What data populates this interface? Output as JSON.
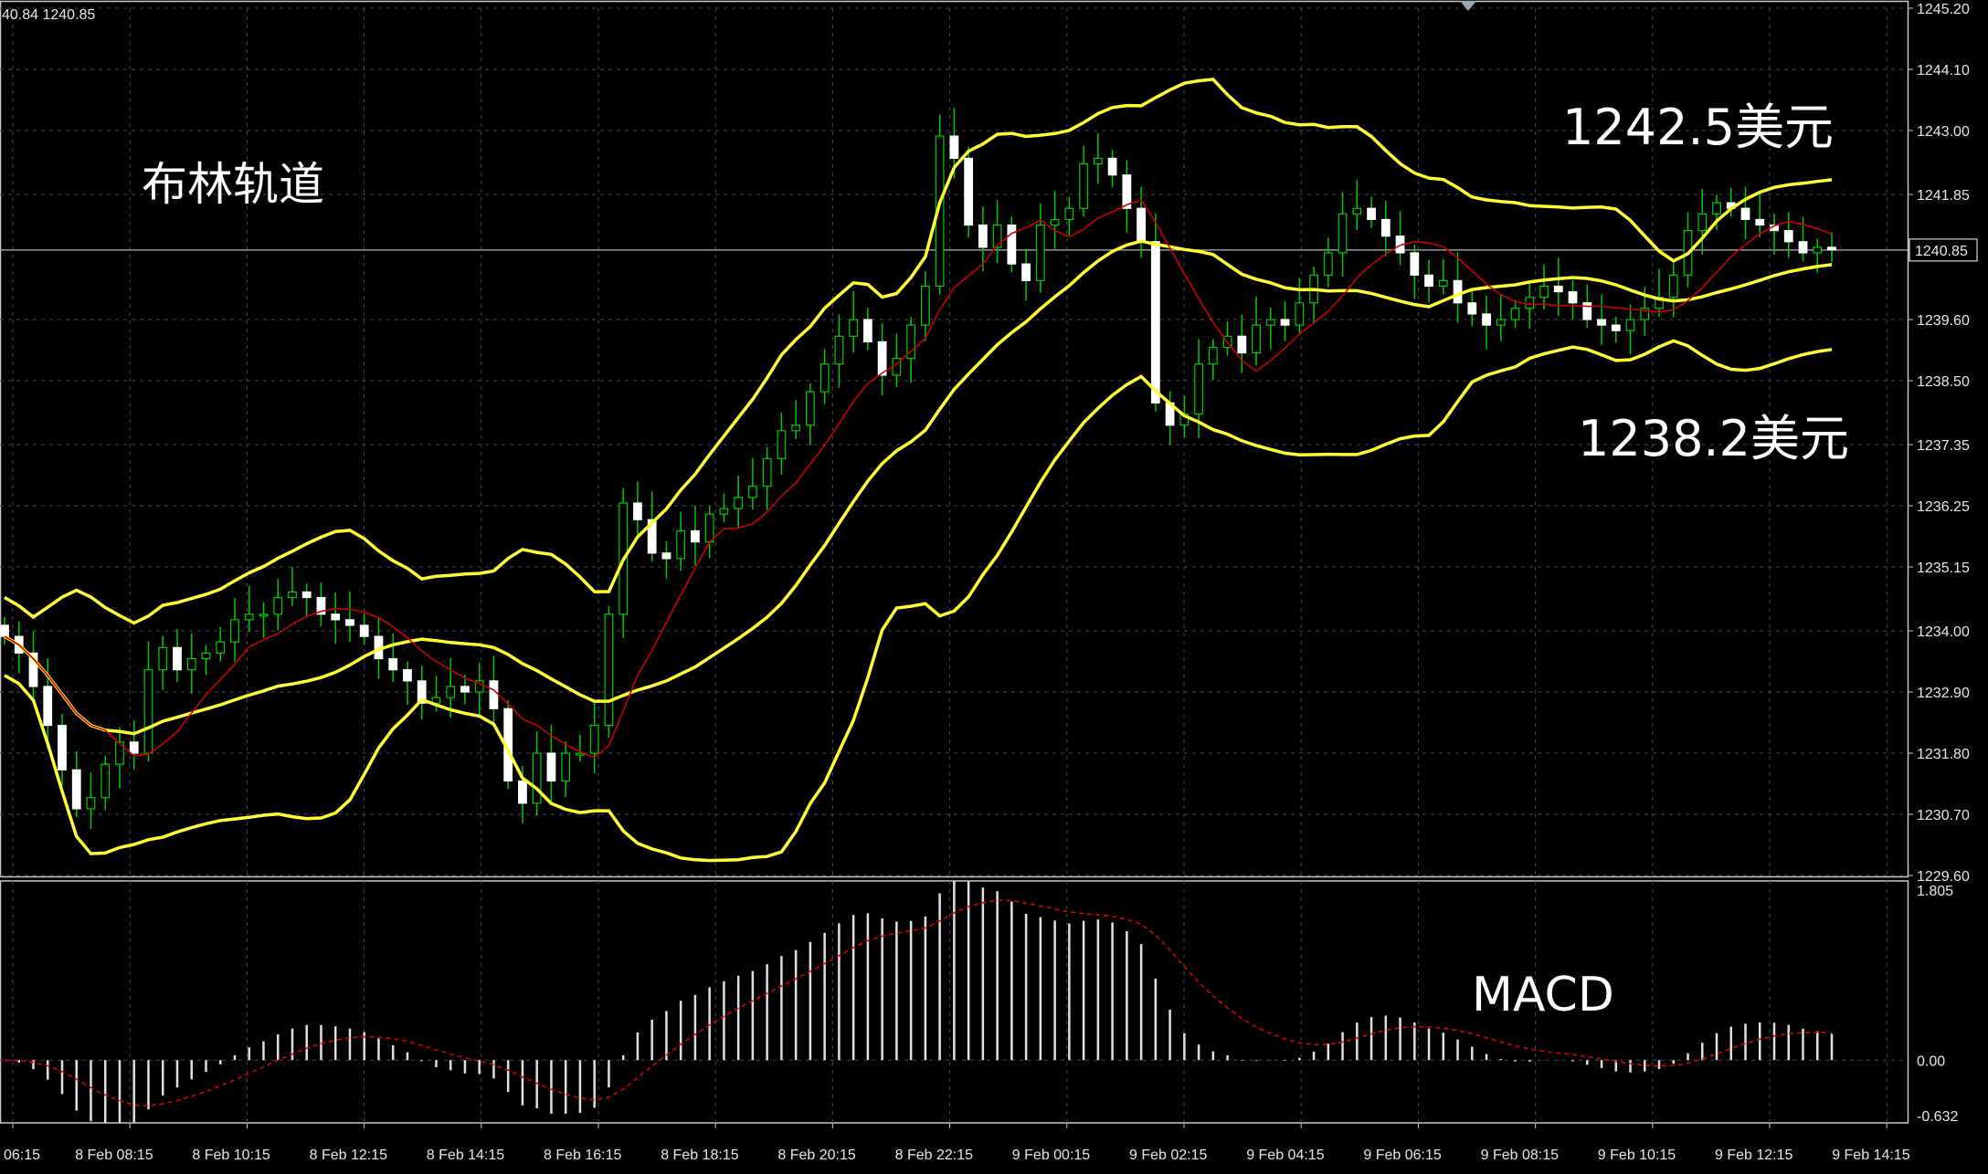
{
  "top_readout": "40.84 1240.85",
  "annotations": {
    "bollinger": "布林轨道",
    "upper_price": "1242.5美元",
    "lower_price": "1238.2美元",
    "macd": "MACD"
  },
  "current_price_label": "1240.85",
  "colors": {
    "background": "#000000",
    "grid": "#3c4a5a",
    "bull_candle": "#ffffff",
    "bear_candle": "#ffffff",
    "wick": "#00cc00",
    "bollinger_bands": "#ffff33",
    "moving_average": "#cc0000",
    "macd_histogram": "#e0e0e0",
    "macd_signal": "#dd0000",
    "axis_text": "#e6e6e6"
  },
  "chart_data": [
    {
      "type": "candlestick",
      "title": "",
      "y_ticks": [
        "1245.20",
        "1244.10",
        "1243.00",
        "1241.85",
        "1240.85",
        "1239.60",
        "1238.50",
        "1237.35",
        "1236.25",
        "1235.15",
        "1234.00",
        "1232.90",
        "1231.80",
        "1230.70",
        "1229.60"
      ],
      "x_ticks": [
        "06:15",
        "8 Feb 08:15",
        "8 Feb 10:15",
        "8 Feb 12:15",
        "8 Feb 14:15",
        "8 Feb 16:15",
        "8 Feb 18:15",
        "8 Feb 20:15",
        "8 Feb 22:15",
        "9 Feb 00:15",
        "9 Feb 02:15",
        "9 Feb 04:15",
        "9 Feb 06:15",
        "9 Feb 08:15",
        "9 Feb 10:15",
        "9 Feb 12:15",
        "9 Feb 14:15"
      ],
      "ylim": [
        1229.6,
        1245.2
      ],
      "current_price": 1240.85,
      "close_series": [
        1233.9,
        1233.6,
        1233.0,
        1232.3,
        1231.5,
        1230.8,
        1231.0,
        1231.6,
        1232.0,
        1231.8,
        1233.3,
        1233.7,
        1233.3,
        1233.5,
        1233.6,
        1233.8,
        1234.2,
        1234.3,
        1234.3,
        1234.6,
        1234.7,
        1234.6,
        1234.3,
        1234.2,
        1234.1,
        1233.9,
        1233.5,
        1233.3,
        1233.1,
        1232.7,
        1232.8,
        1233.0,
        1232.9,
        1233.1,
        1232.6,
        1231.3,
        1230.9,
        1231.8,
        1231.3,
        1231.8,
        1231.8,
        1232.3,
        1234.3,
        1236.3,
        1236.0,
        1235.4,
        1235.3,
        1235.8,
        1235.6,
        1236.1,
        1236.2,
        1236.4,
        1236.6,
        1237.1,
        1237.6,
        1237.7,
        1238.3,
        1238.8,
        1239.3,
        1239.6,
        1239.2,
        1238.6,
        1238.9,
        1239.5,
        1240.2,
        1242.9,
        1242.5,
        1241.3,
        1240.9,
        1241.3,
        1240.6,
        1240.3,
        1241.3,
        1241.4,
        1241.6,
        1242.4,
        1242.5,
        1242.2,
        1241.6,
        1241.0,
        1238.1,
        1237.7,
        1237.9,
        1238.8,
        1239.1,
        1239.3,
        1239.0,
        1239.5,
        1239.6,
        1239.5,
        1239.9,
        1240.4,
        1240.8,
        1241.5,
        1241.6,
        1241.4,
        1241.1,
        1240.8,
        1240.4,
        1240.2,
        1240.3,
        1239.9,
        1239.7,
        1239.5,
        1239.6,
        1239.8,
        1240.0,
        1240.2,
        1240.1,
        1239.9,
        1239.6,
        1239.5,
        1239.4,
        1239.6,
        1239.8,
        1240.0,
        1240.4,
        1241.2,
        1241.5,
        1241.7,
        1241.6,
        1241.4,
        1241.3,
        1241.2,
        1241.0,
        1240.8,
        1240.9,
        1240.85
      ]
    },
    {
      "type": "macd",
      "title": "MACD",
      "y_ticks": [
        "1.805",
        "0.00",
        "-0.632"
      ],
      "ylim": [
        -0.632,
        1.805
      ]
    }
  ]
}
